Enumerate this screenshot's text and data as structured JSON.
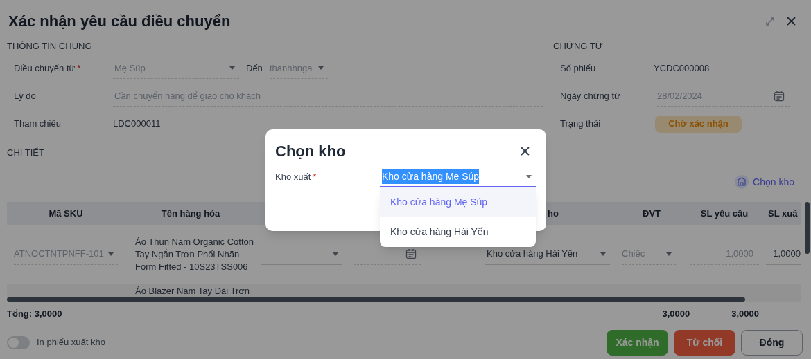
{
  "dialog": {
    "title": "Xác nhận yêu cầu điều chuyển"
  },
  "general": {
    "heading": "THÔNG TIN CHUNG",
    "transfer_from": {
      "label": "Điều chuyển từ",
      "required_mark": "*",
      "value": "Mẹ Súp",
      "disabled": true
    },
    "to": {
      "label": "Đến",
      "value": "thanhhnga",
      "disabled": true
    },
    "reason": {
      "label": "Lý do",
      "value": "Cần chuyển hàng để giao cho khách",
      "disabled": true
    },
    "reference": {
      "label": "Tham chiếu",
      "value": "LDC000011"
    }
  },
  "document": {
    "heading": "CHỨNG TỪ",
    "number": {
      "label": "Số phiếu",
      "value": "YCDC000008"
    },
    "date": {
      "label": "Ngày chứng từ",
      "value": "28/02/2024",
      "disabled": true
    },
    "status": {
      "label": "Trạng thái",
      "value": "Chờ xác nhận"
    }
  },
  "details": {
    "heading": "CHI TIẾT",
    "choose_warehouse_link": "Chọn kho",
    "table": {
      "columns": [
        "Mã SKU",
        "Tên hàng hóa",
        "ho",
        "ĐVT",
        "SL yêu cầu",
        "SL xuấ"
      ],
      "rows": [
        {
          "sku": "ATNOCTNTPNFF-101",
          "name": "Áo Thun Nam Organic Cotton Tay Ngắn Trơn Phối Nhãn Form Fitted - 10S23TSS006",
          "warehouse": "Kho cửa hàng Hải Yến",
          "unit": "Chiếc",
          "requested": "1,0000",
          "issued": "1,0000"
        },
        {
          "name": "Áo Blazer Nam Tay Dài Trơn"
        }
      ]
    },
    "totals": {
      "label": "Tổng: 3,0000",
      "requested": "3,0000",
      "issued": "3,0000"
    }
  },
  "footer": {
    "print_toggle": {
      "label": "In phiếu xuất kho",
      "on": false
    },
    "buttons": [
      {
        "kind": "confirm",
        "label": "Xác nhận"
      },
      {
        "kind": "reject",
        "label": "Từ chối"
      },
      {
        "kind": "close",
        "label": "Đóng"
      }
    ]
  },
  "picker": {
    "title": "Chọn kho",
    "field": {
      "label": "Kho xuất",
      "required_mark": "*",
      "value": "Kho cửa hàng Me Súp",
      "highlighted": true
    },
    "options": [
      {
        "label": "Kho cửa hàng Mẹ Súp",
        "selected": true
      },
      {
        "label": "Kho cửa hàng Hải Yến",
        "selected": false
      }
    ]
  }
}
